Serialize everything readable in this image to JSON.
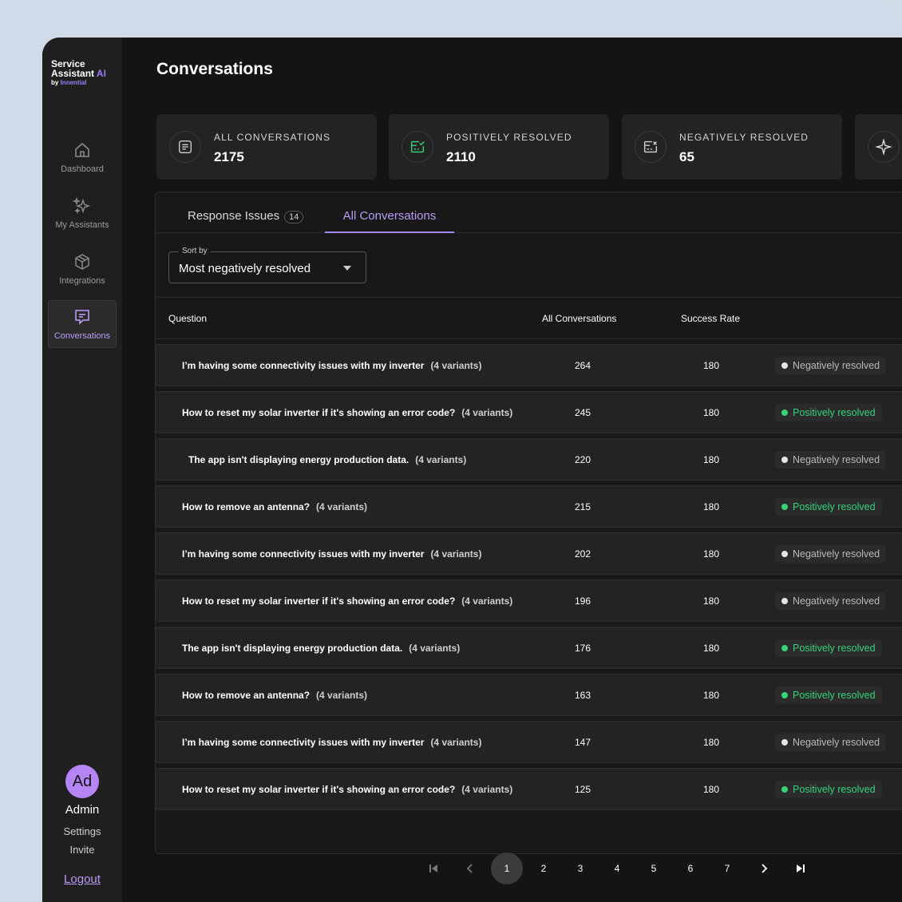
{
  "app": {
    "logo_line1": "Service",
    "logo_line2": "Assistant",
    "logo_ai": "AI",
    "logo_by": "by",
    "logo_brand": "Innential"
  },
  "sidebar": {
    "items": [
      {
        "label": "Dashboard",
        "icon": "home-icon"
      },
      {
        "label": "My Assistants",
        "icon": "sparkles-icon"
      },
      {
        "label": "Integrations",
        "icon": "package-icon"
      },
      {
        "label": "Conversations",
        "icon": "chat-icon",
        "active": true
      }
    ],
    "avatar_initials": "Ad",
    "user_name": "Admin",
    "settings": "Settings",
    "invite": "Invite",
    "logout": "Logout"
  },
  "page": {
    "title": "Conversations"
  },
  "stats": [
    {
      "label": "ALL CONVERSATIONS",
      "value": "2175",
      "icon": "document-icon"
    },
    {
      "label": "POSITIVELY RESOLVED",
      "value": "2110",
      "icon": "check-card-icon"
    },
    {
      "label": "NEGATIVELY RESOLVED",
      "value": "65",
      "icon": "x-card-icon"
    },
    {
      "label": "",
      "value": "",
      "icon": "sparkle-icon"
    }
  ],
  "tabs": {
    "response_issues": "Response Issues",
    "response_issues_count": "14",
    "all_conversations": "All Conversations"
  },
  "sort": {
    "legend": "Sort by",
    "value": "Most negatively resolved"
  },
  "table": {
    "headers": {
      "question": "Question",
      "all_conversations": "All Conversations",
      "success_rate": "Success Rate"
    },
    "rows": [
      {
        "question": "I’m having some connectivity issues with my inverter",
        "variants": "(4 variants)",
        "count": "264",
        "rate": "180",
        "status": "Negatively resolved",
        "type": "neg"
      },
      {
        "question": "How to reset my solar inverter if it's showing an error code?",
        "variants": "(4 variants)",
        "count": "245",
        "rate": "180",
        "status": "Positively resolved",
        "type": "pos"
      },
      {
        "question": "The app isn't displaying  energy production data.",
        "variants": "(4 variants)",
        "count": "220",
        "rate": "180",
        "status": "Negatively resolved",
        "type": "neg"
      },
      {
        "question": "How to remove an antenna?",
        "variants": "(4 variants)",
        "count": "215",
        "rate": "180",
        "status": "Positively resolved",
        "type": "pos"
      },
      {
        "question": "I’m having some connectivity issues with my inverter",
        "variants": "(4 variants)",
        "count": "202",
        "rate": "180",
        "status": "Negatively resolved",
        "type": "neg"
      },
      {
        "question": "How to reset my solar inverter if it's showing an error code?",
        "variants": "(4 variants)",
        "count": "196",
        "rate": "180",
        "status": "Negatively resolved",
        "type": "neg"
      },
      {
        "question": "The app isn't displaying  energy production data.",
        "variants": "(4 variants)",
        "count": "176",
        "rate": "180",
        "status": "Positively resolved",
        "type": "pos"
      },
      {
        "question": "How to remove an antenna?",
        "variants": "(4 variants)",
        "count": "163",
        "rate": "180",
        "status": "Positively resolved",
        "type": "pos"
      },
      {
        "question": "I’m having some connectivity issues with my inverter",
        "variants": "(4 variants)",
        "count": "147",
        "rate": "180",
        "status": "Negatively resolved",
        "type": "neg"
      },
      {
        "question": "How to reset my solar inverter if it's showing an error code?",
        "variants": "(4 variants)",
        "count": "125",
        "rate": "180",
        "status": "Positively resolved",
        "type": "pos"
      }
    ]
  },
  "pagination": {
    "pages": [
      "1",
      "2",
      "3",
      "4",
      "5",
      "6",
      "7"
    ],
    "current": "1"
  },
  "colors": {
    "accent": "#a98cf2",
    "positive": "#36d37a",
    "negative": "#e5e5e5",
    "background": "#141414"
  }
}
